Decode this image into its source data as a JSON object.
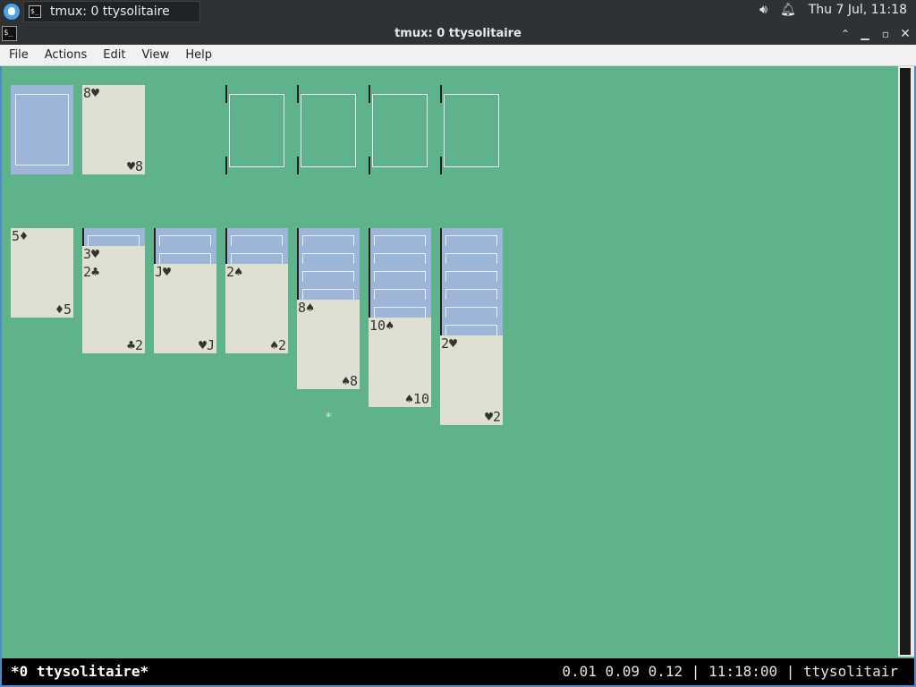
{
  "panel": {
    "task_label": "tmux: 0 ttysolitaire",
    "clock": "Thu  7 Jul, 11:18",
    "terminal_glyph": "$_"
  },
  "window": {
    "title": "tmux: 0 ttysolitaire"
  },
  "menu": {
    "items": [
      "File",
      "Actions",
      "Edit",
      "View",
      "Help"
    ]
  },
  "game": {
    "waste": {
      "rank": "8",
      "suit": "♥"
    },
    "foundations": [
      "",
      "",
      "",
      ""
    ],
    "tableau": [
      {
        "hidden": 0,
        "rank": "5",
        "suit": "♦"
      },
      {
        "hidden": 1,
        "rank": "3",
        "suit": "♥",
        "extra": {
          "rank": "2",
          "suit": "♣"
        }
      },
      {
        "hidden": 2,
        "rank": "J",
        "suit": "♥"
      },
      {
        "hidden": 2,
        "rank": "2",
        "suit": "♠"
      },
      {
        "hidden": 4,
        "rank": "8",
        "suit": "♠"
      },
      {
        "hidden": 5,
        "rank": "10",
        "suit": "♠"
      },
      {
        "hidden": 6,
        "rank": "2",
        "suit": "♥"
      }
    ],
    "cursor": "*"
  },
  "status": {
    "left": "*0 ttysolitaire*",
    "right": "0.01 0.09 0.12 | 11:18:00 | ttysolitair"
  }
}
